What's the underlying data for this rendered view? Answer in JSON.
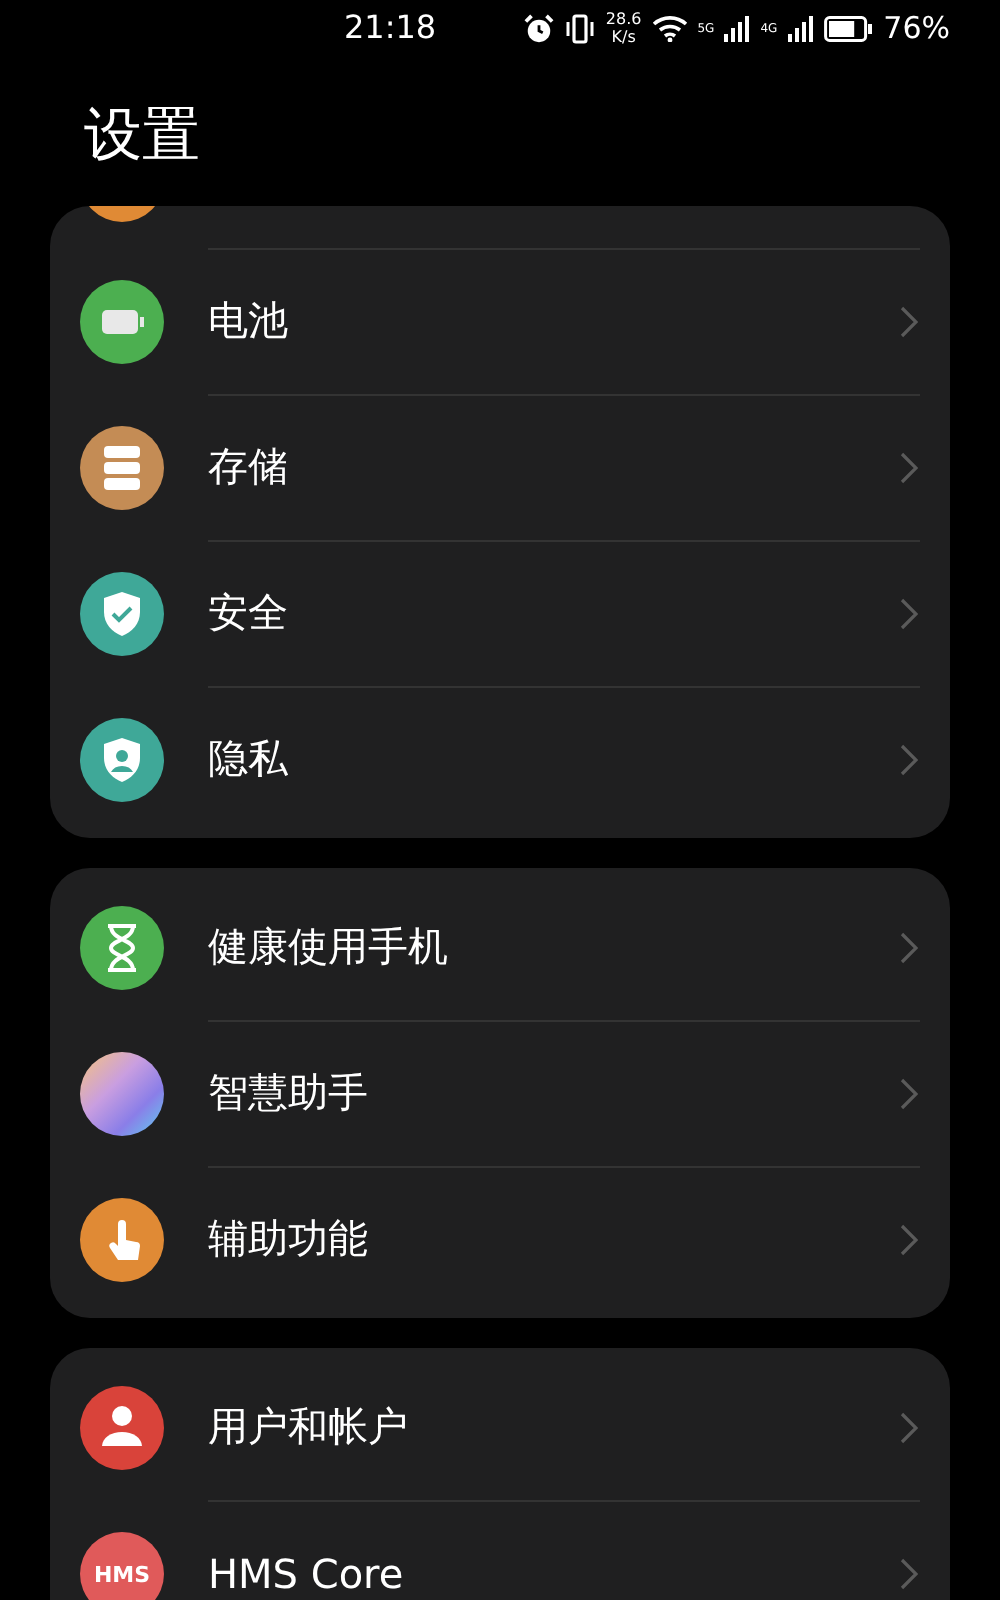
{
  "status_bar": {
    "time": "21:18",
    "speed_value": "28.6",
    "speed_unit": "K/s",
    "network_1": "5G",
    "network_2": "4G",
    "battery_percent": "76%"
  },
  "title": "设置",
  "groups": [
    {
      "partial_top": true,
      "items": [
        {
          "label": "电池",
          "kind": "battery",
          "color": "#4caf50"
        },
        {
          "label": "存储",
          "kind": "storage",
          "color": "#c48c55"
        },
        {
          "label": "安全",
          "kind": "security",
          "color": "#3fa898"
        },
        {
          "label": "隐私",
          "kind": "privacy",
          "color": "#3fa898"
        }
      ]
    },
    {
      "partial_top": false,
      "items": [
        {
          "label": "健康使用手机",
          "kind": "hourglass",
          "color": "#4caf50"
        },
        {
          "label": "智慧助手",
          "kind": "assistant",
          "color": "#c99ee0"
        },
        {
          "label": "辅助功能",
          "kind": "accessibility",
          "color": "#e08a35"
        }
      ]
    },
    {
      "partial_top": false,
      "items": [
        {
          "label": "用户和帐户",
          "kind": "user",
          "color": "#d9433a"
        },
        {
          "label": "HMS Core",
          "kind": "hms",
          "color": "#e05a5a",
          "icon_text": "HMS"
        }
      ]
    }
  ]
}
